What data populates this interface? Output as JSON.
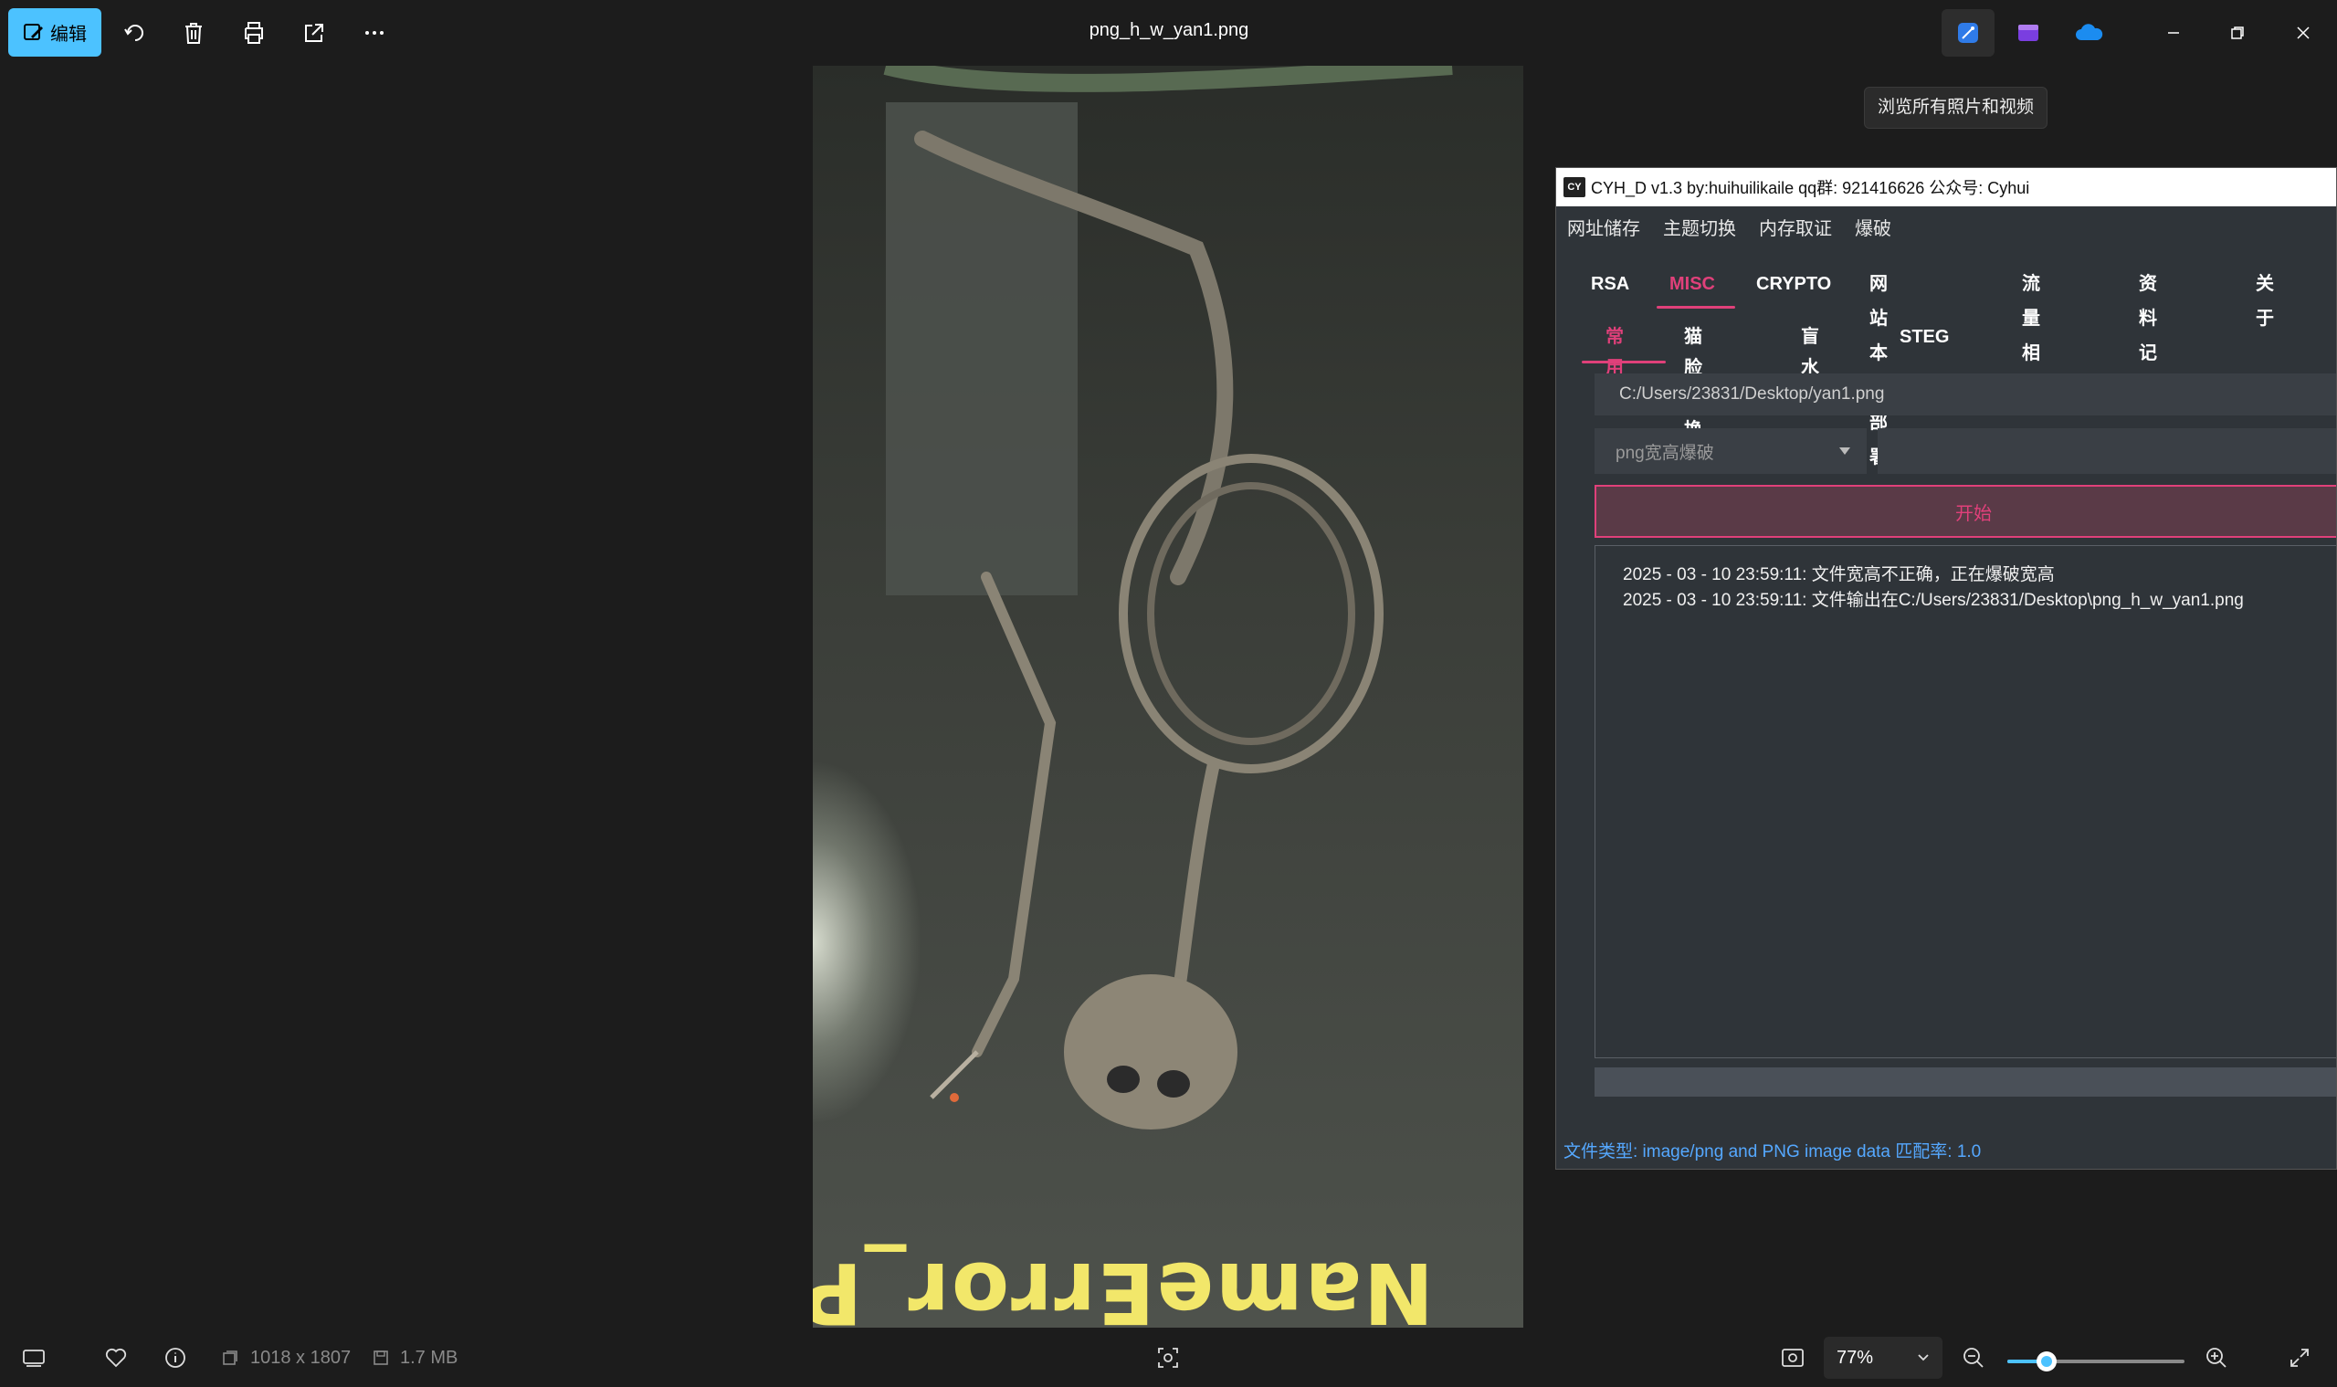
{
  "toolbar": {
    "edit_label": "编辑",
    "file_title": "png_h_w_yan1.png",
    "tooltip": "浏览所有照片和视频"
  },
  "photo": {
    "watermark_text": "NameError_P"
  },
  "statusbar": {
    "dimensions": "1018 x 1807",
    "file_size": "1.7 MB",
    "zoom_value": "77%",
    "zoom_fraction": 0.22
  },
  "cyh": {
    "title": "CYH_D v1.3 by:huihuilikaile qq群: 921416626 公众号: Cyhui",
    "logo_text": "CY",
    "menu": [
      "网址储存",
      "主题切换",
      "内存取证",
      "爆破"
    ],
    "tabs": [
      "RSA",
      "MISC",
      "CRYPTO",
      "网站本地部署",
      "流量相关",
      "资料记录",
      "关于"
    ],
    "active_tab": "MISC",
    "subtabs": [
      "常用",
      "猫脸变换",
      "盲水印",
      "STEG"
    ],
    "active_subtab": "常用",
    "file_path": "C:/Users/23831/Desktop/yan1.png",
    "mode_select": "png宽高爆破",
    "start_label": "开始",
    "log_lines": [
      "2025 - 03 - 10 23:59:11: 文件宽高不正确，正在爆破宽高",
      "2025 - 03 - 10 23:59:11: 文件输出在C:/Users/23831/Desktop\\png_h_w_yan1.png"
    ],
    "status_text": "文件类型: image/png and PNG image data 匹配率: 1.0"
  }
}
